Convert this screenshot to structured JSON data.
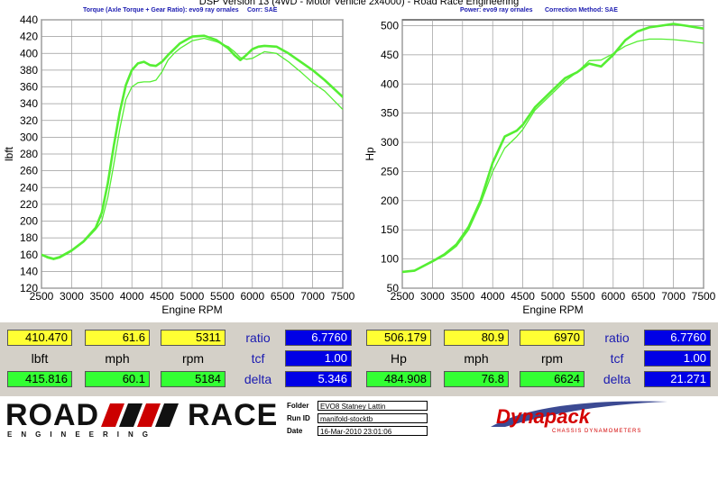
{
  "title": "DSP Version 13 (4WD - Motor Vehicle 2x4000) - Road Race Engineering",
  "left_header": {
    "series": "Torque (Axle Torque + Gear Ratio): evo9 ray ornales",
    "corr": "Corr: SAE"
  },
  "right_header": {
    "series": "Power: evo9 ray ornales",
    "corr": "Correction Method: SAE"
  },
  "colors": {
    "curve": "#55ee33",
    "yellow": "#ffff33",
    "green": "#33ff33",
    "blue": "#0000e6",
    "panel_bg": "#d4d0c8"
  },
  "chart_data": [
    {
      "type": "line",
      "xlabel": "Engine RPM",
      "ylabel": "lbft",
      "xlim": [
        2500,
        7500
      ],
      "ylim": [
        120,
        440
      ],
      "x_ticks": [
        "2500",
        "3000",
        "3500",
        "4000",
        "4500",
        "5000",
        "5500",
        "6000",
        "6500",
        "7000",
        "7500"
      ],
      "y_ticks": [
        "120",
        "140",
        "160",
        "180",
        "200",
        "220",
        "240",
        "260",
        "280",
        "300",
        "320",
        "340",
        "360",
        "380",
        "400",
        "420",
        "440"
      ],
      "grid": true,
      "series": [
        {
          "line": "thick",
          "x": [
            2500,
            2600,
            2700,
            2800,
            3000,
            3200,
            3400,
            3500,
            3600,
            3700,
            3800,
            3900,
            4000,
            4100,
            4200,
            4300,
            4400,
            4500,
            4600,
            4700,
            4800,
            5000,
            5200,
            5400,
            5600,
            5700,
            5800,
            5900,
            6000,
            6100,
            6200,
            6400,
            6600,
            6800,
            7000,
            7200,
            7500
          ],
          "y": [
            160,
            157,
            155,
            157,
            165,
            176,
            192,
            210,
            245,
            290,
            330,
            362,
            380,
            388,
            390,
            386,
            385,
            390,
            398,
            405,
            412,
            420,
            421,
            416,
            406,
            398,
            392,
            398,
            405,
            408,
            409,
            408,
            400,
            390,
            380,
            368,
            348
          ]
        },
        {
          "line": "thin",
          "x": [
            2500,
            2600,
            2700,
            2800,
            3000,
            3200,
            3400,
            3500,
            3600,
            3700,
            3800,
            3900,
            4000,
            4100,
            4200,
            4300,
            4400,
            4500,
            4600,
            4700,
            4800,
            5000,
            5200,
            5400,
            5600,
            5700,
            5800,
            5900,
            6000,
            6100,
            6200,
            6400,
            6600,
            6800,
            7000,
            7200,
            7500
          ],
          "y": [
            160,
            156,
            154,
            156,
            164,
            175,
            190,
            200,
            228,
            268,
            310,
            345,
            360,
            365,
            366,
            366,
            368,
            378,
            392,
            400,
            406,
            415,
            418,
            414,
            408,
            402,
            395,
            393,
            394,
            398,
            402,
            400,
            390,
            378,
            365,
            355,
            333
          ]
        }
      ]
    },
    {
      "type": "line",
      "xlabel": "Engine RPM",
      "ylabel": "Hp",
      "xlim": [
        2500,
        7500
      ],
      "ylim": [
        50,
        510
      ],
      "x_ticks": [
        "2500",
        "3000",
        "3500",
        "4000",
        "4500",
        "5000",
        "5500",
        "6000",
        "6500",
        "7000",
        "7500"
      ],
      "y_ticks": [
        "50",
        "100",
        "150",
        "200",
        "250",
        "300",
        "350",
        "400",
        "450",
        "500"
      ],
      "grid": true,
      "series": [
        {
          "line": "thick",
          "x": [
            2500,
            2700,
            3000,
            3200,
            3400,
            3600,
            3800,
            4000,
            4200,
            4400,
            4500,
            4700,
            5000,
            5200,
            5400,
            5600,
            5800,
            6000,
            6200,
            6400,
            6600,
            6800,
            7000,
            7200,
            7500
          ],
          "y": [
            78,
            80,
            96,
            108,
            125,
            155,
            200,
            265,
            310,
            320,
            330,
            360,
            390,
            410,
            420,
            435,
            430,
            450,
            475,
            490,
            497,
            500,
            503,
            500,
            495
          ]
        },
        {
          "line": "thin",
          "x": [
            2500,
            2700,
            3000,
            3200,
            3400,
            3600,
            3800,
            4000,
            4200,
            4400,
            4500,
            4700,
            5000,
            5200,
            5400,
            5600,
            5800,
            6000,
            6200,
            6400,
            6600,
            6800,
            7000,
            7200,
            7500
          ],
          "y": [
            78,
            80,
            95,
            106,
            122,
            150,
            195,
            250,
            290,
            310,
            322,
            355,
            385,
            405,
            420,
            440,
            441,
            452,
            465,
            473,
            477,
            477,
            476,
            474,
            470
          ]
        }
      ]
    }
  ],
  "left_readout": {
    "row1": {
      "v1": "410.470",
      "v2": "61.6",
      "v3": "5311",
      "label": "ratio",
      "v4": "6.7760"
    },
    "row2": {
      "l1": "lbft",
      "l2": "mph",
      "l3": "rpm",
      "label": "tcf",
      "v4": "1.00"
    },
    "row3": {
      "v1": "415.816",
      "v2": "60.1",
      "v3": "5184",
      "label": "delta",
      "v4": "5.346"
    }
  },
  "right_readout": {
    "row1": {
      "v1": "506.179",
      "v2": "80.9",
      "v3": "6970",
      "label": "ratio",
      "v4": "6.7760"
    },
    "row2": {
      "l1": "Hp",
      "l2": "mph",
      "l3": "rpm",
      "label": "tcf",
      "v4": "1.00"
    },
    "row3": {
      "v1": "484.908",
      "v2": "76.8",
      "v3": "6624",
      "label": "delta",
      "v4": "21.271"
    }
  },
  "footer": {
    "logo_left_line1a": "ROAD",
    "logo_left_line1b": "RACE",
    "logo_left_line2": "ENGINEERING",
    "folder_label": "Folder",
    "folder_value": "EVO8 Statney Lattin",
    "run_label": "Run ID",
    "run_value": "manifold-stocktb",
    "date_label": "Date",
    "date_value": "16-Mar-2010 23:01:06",
    "logo_right": "Dynapack",
    "logo_right_sub": "CHASSIS DYNAMOMETERS"
  }
}
